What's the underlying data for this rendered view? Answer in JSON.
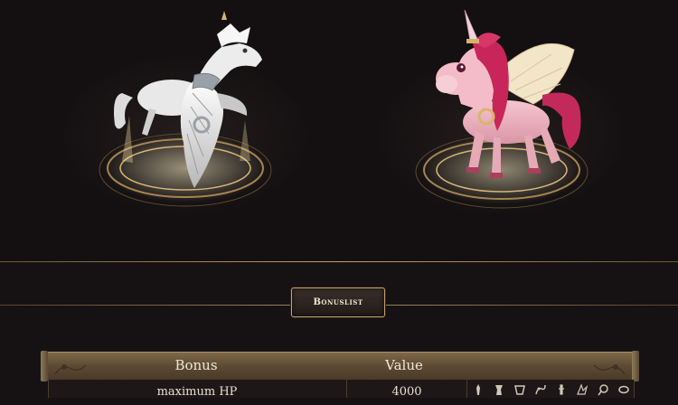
{
  "tabs": {
    "bonuslist_label": "Bonuslist"
  },
  "table": {
    "headers": {
      "bonus": "Bonus",
      "value": "Value"
    },
    "rows": [
      {
        "bonus": "maximum HP",
        "value": "4000",
        "icons": [
          "warrior-icon",
          "ninja-icon",
          "sura-icon",
          "shaman-icon",
          "lycan-icon",
          "mount-icon",
          "ring-icon",
          "shoe-icon"
        ]
      }
    ]
  },
  "colors": {
    "accent_gold": "#c2a26e",
    "background": "#161213",
    "header_bronze": "#6b5840"
  }
}
